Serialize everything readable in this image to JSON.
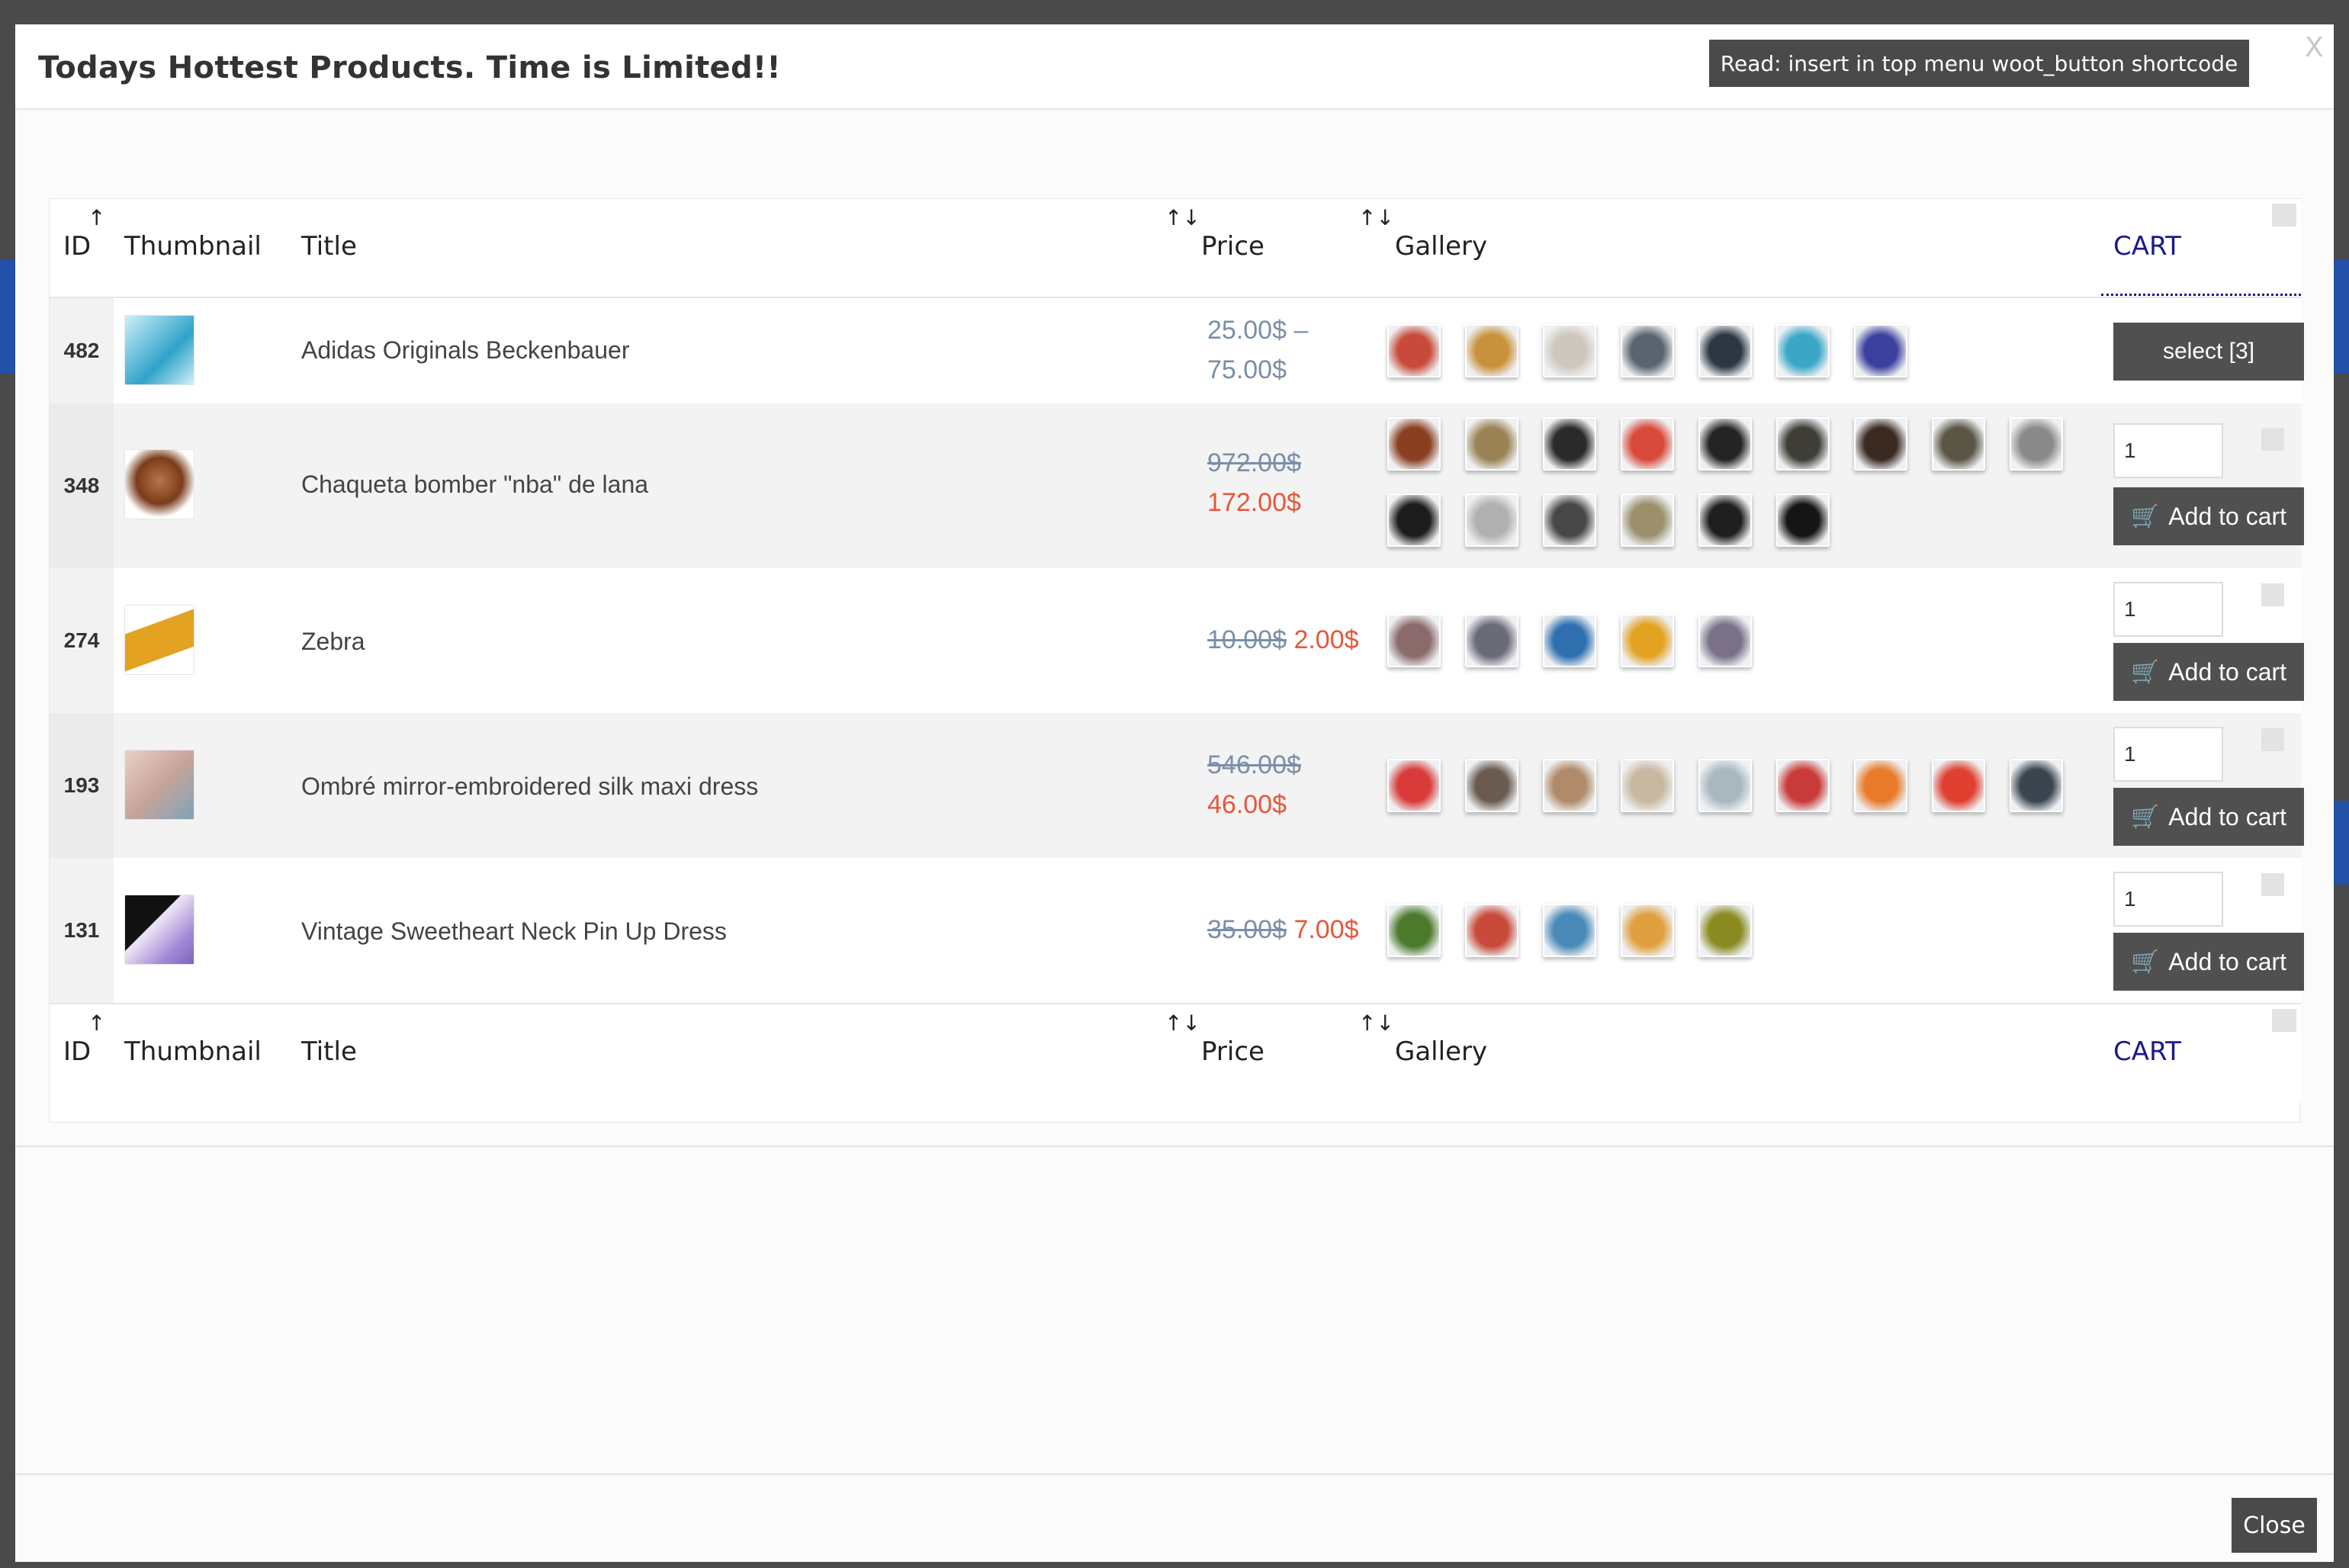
{
  "modal": {
    "title": "Todays Hottest Products. Time is Limited!!",
    "notice_button": "Read: insert in top menu woot_button shortcode",
    "close_x": "X",
    "close_button": "Close"
  },
  "table": {
    "columns": {
      "id": "ID",
      "thumbnail": "Thumbnail",
      "title": "Title",
      "price": "Price",
      "gallery": "Gallery",
      "cart": "CART"
    },
    "sort_icons": {
      "id": "↑",
      "title": "↑↓",
      "price": "↑↓"
    },
    "rows": [
      {
        "id": "482",
        "title": "Adidas Originals Beckenbauer",
        "price_line1": "25.00$ –",
        "price_line2": "75.00$",
        "thumb_colors": [
          "#2fa3c9",
          "#d0f0fa"
        ],
        "gallery": [
          "#c94a3a",
          "#c9913c",
          "#cfc7bd",
          "#5a6470",
          "#2b3844",
          "#3ba7c7",
          "#3b3f9e"
        ],
        "action": "select [3]"
      },
      {
        "id": "348",
        "title": "Chaqueta bomber \"nba\" de lana",
        "old_price": "972.00$",
        "new_price": "172.00$",
        "thumb_colors": [
          "#7a3c1c",
          "#b8754a"
        ],
        "gallery": [
          "#8a3f20",
          "#9a8254",
          "#2a2a2a",
          "#d94a3b",
          "#242424",
          "#3e3e36",
          "#3a2a22",
          "#5b5546",
          "#8a8a8a",
          "#1c1c1c",
          "#b0b0b0",
          "#474747",
          "#9c8f6c",
          "#1f1f1f",
          "#151515"
        ],
        "qty": "1",
        "action": "Add to cart"
      },
      {
        "id": "274",
        "title": "Zebra",
        "old_price": "10.00$",
        "new_price": "2.00$",
        "thumb_colors": [
          "#e3a222",
          "#2a2a2a"
        ],
        "gallery": [
          "#8a6a6a",
          "#6a6a78",
          "#2e6fb0",
          "#e3a222",
          "#7a7088"
        ],
        "qty": "1",
        "action": "Add to cart"
      },
      {
        "id": "193",
        "title": "Ombré mirror-embroidered silk maxi dress",
        "old_price": "546.00$",
        "new_price": "46.00$",
        "thumb_colors": [
          "#c9a49a",
          "#7fa3b8"
        ],
        "gallery": [
          "#d93a3a",
          "#6a5a50",
          "#b08a6a",
          "#c9b8a0",
          "#a8b8c0",
          "#c93a3a",
          "#e87a2a",
          "#e04030",
          "#3a4550"
        ],
        "qty": "1",
        "action": "Add to cart"
      },
      {
        "id": "131",
        "title": "Vintage Sweetheart Neck Pin Up Dress",
        "old_price": "35.00$",
        "new_price": "7.00$",
        "thumb_colors": [
          "#111111",
          "#a38ad8"
        ],
        "gallery": [
          "#4a7a2a",
          "#c94a3a",
          "#4a8ab8",
          "#e0a040",
          "#8a8a20"
        ],
        "qty": "1",
        "action": "Add to cart"
      }
    ]
  }
}
